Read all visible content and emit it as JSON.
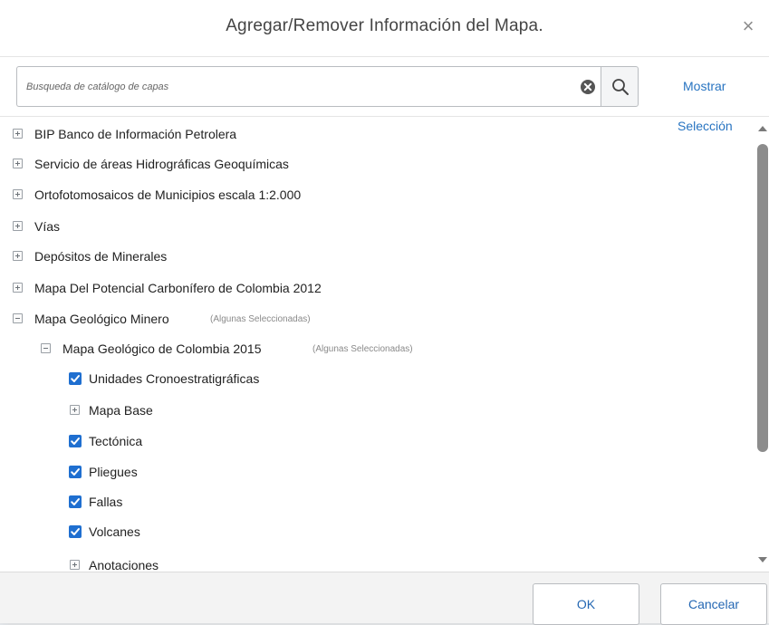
{
  "dialog": {
    "title": "Agregar/Remover Información del Mapa.",
    "close_label": "×"
  },
  "search": {
    "placeholder": "Busqueda de catálogo de capas",
    "value": ""
  },
  "show_selection": {
    "line1": "Mostrar",
    "line2": "Selección"
  },
  "tree": {
    "items": [
      {
        "label": "BIP Banco de Información Petrolera",
        "state": "collapsed"
      },
      {
        "label": "Servicio de áreas Hidrográficas Geoquímicas",
        "state": "collapsed"
      },
      {
        "label": "Ortofotomosaicos de Municipios escala 1:2.000",
        "state": "collapsed"
      },
      {
        "label": "Vías",
        "state": "collapsed"
      },
      {
        "label": "Depósitos de Minerales",
        "state": "collapsed"
      },
      {
        "label": "Mapa Del Potencial Carbonífero de Colombia 2012",
        "state": "collapsed"
      },
      {
        "label": "Mapa Geológico Minero",
        "note": "(Algunas Seleccionadas)",
        "state": "expanded"
      },
      {
        "label": "Mapa Geológico de Colombia 2015",
        "note": "(Algunas Seleccionadas)",
        "state": "expanded"
      },
      {
        "label": "Unidades Cronoestratigráficas",
        "state": "checked"
      },
      {
        "label": "Mapa Base",
        "state": "collapsed"
      },
      {
        "label": "Tectónica",
        "state": "checked"
      },
      {
        "label": "Pliegues",
        "state": "checked"
      },
      {
        "label": "Fallas",
        "state": "checked"
      },
      {
        "label": "Volcanes",
        "state": "checked"
      },
      {
        "label": "Anotaciones",
        "state": "collapsed"
      }
    ]
  },
  "footer": {
    "ok_label": "OK",
    "cancel_label": "Cancelar"
  },
  "colors": {
    "accent": "#2874c1",
    "checkbox": "#1f6fd0",
    "scroll_thumb": "#8c8c8c"
  }
}
